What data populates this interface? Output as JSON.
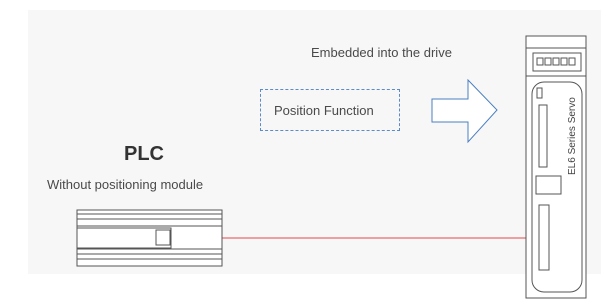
{
  "labels": {
    "embedded": "Embedded into the drive",
    "position_function": "Position Function",
    "plc_title": "PLC",
    "plc_subtitle": "Without positioning module",
    "servo_name": "EL6 Series Servo"
  },
  "colors": {
    "background_panel": "#f7f7f8",
    "arrow_outline": "#4a7fc1",
    "dashed_box": "#5b8bc9",
    "connection_line": "#e3474b",
    "device_outline": "#555555"
  }
}
